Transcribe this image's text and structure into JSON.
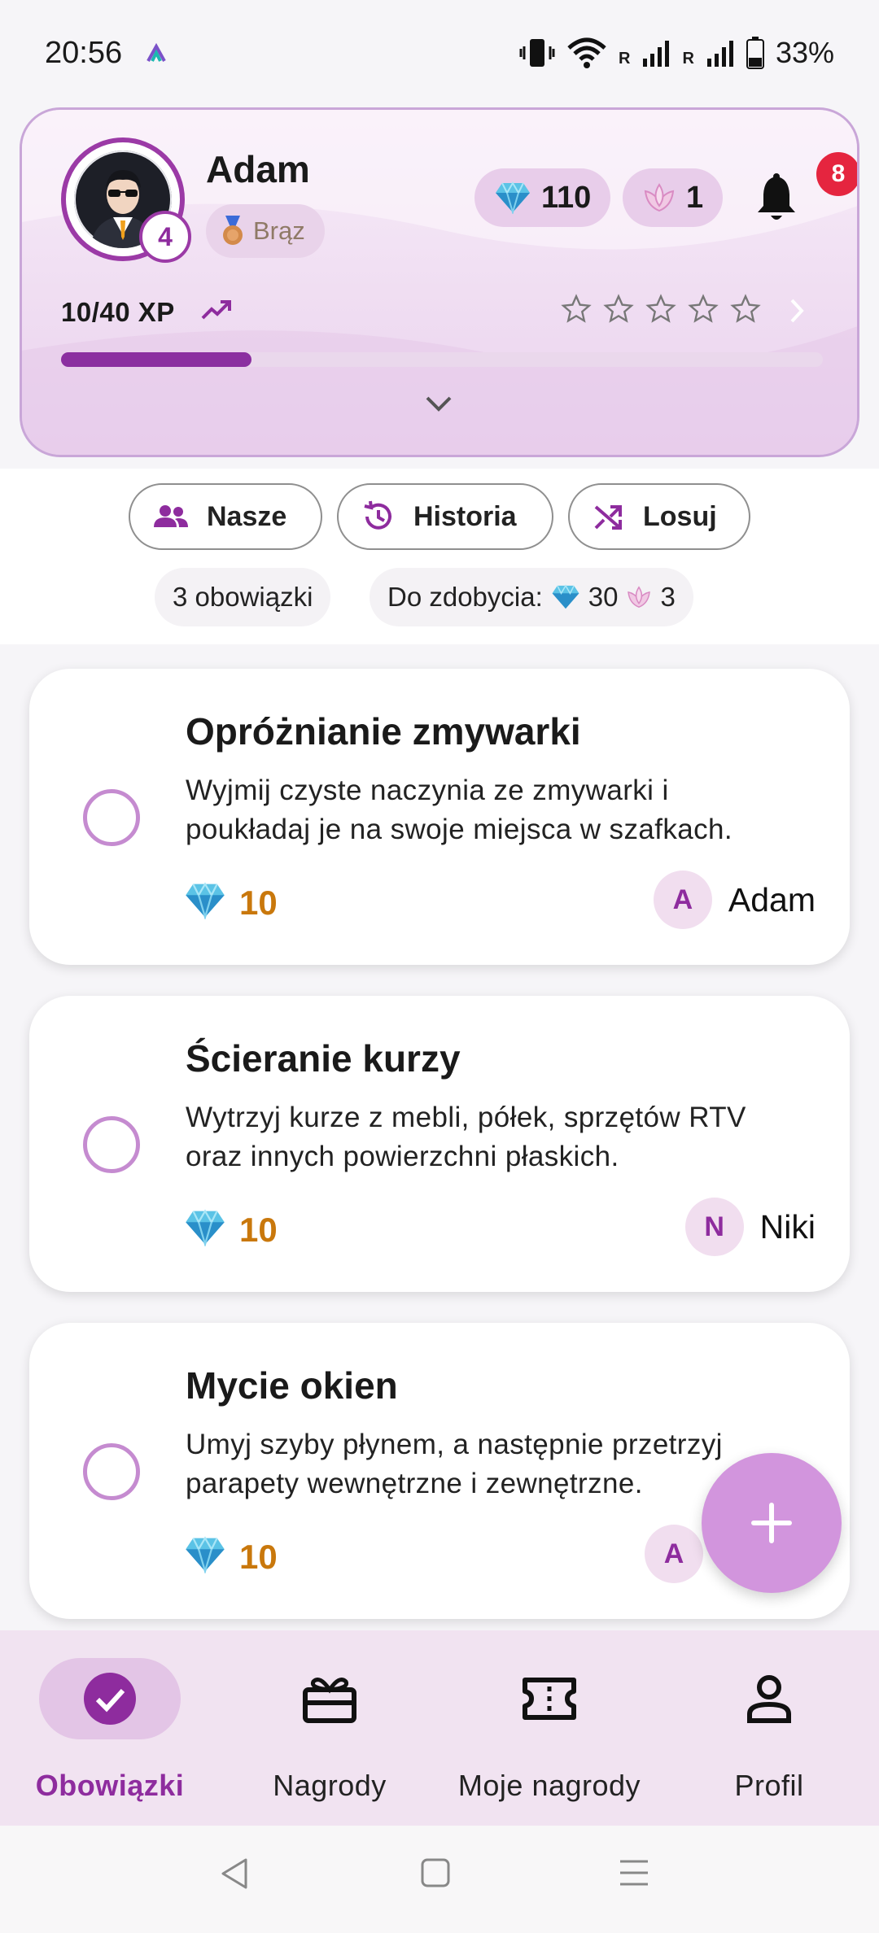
{
  "status_bar": {
    "time": "20:56",
    "roaming1": "R",
    "roaming2": "R",
    "battery": "33%"
  },
  "profile": {
    "name": "Adam",
    "level": "4",
    "rank": "Brąz",
    "gems": "110",
    "flowers": "1",
    "notifications": "8",
    "xp_text": "10/40 XP",
    "xp_progress": 0.25,
    "stars_filled": 0,
    "stars_total": 5
  },
  "filters": {
    "ours": "Nasze",
    "history": "Historia",
    "random": "Losuj"
  },
  "summary": {
    "count": "3 obowiązki",
    "earn_label": "Do zdobycia:",
    "earn_gems": "30",
    "earn_flowers": "3"
  },
  "tasks": [
    {
      "title": "Opróżnianie zmywarki",
      "desc_line1": "Wyjmij czyste naczynia ze zmywarki i",
      "desc_line2": "poukładaj je na swoje miejsca w szafkach.",
      "points": "10",
      "assignee_initial": "A",
      "assignee_name": "Adam"
    },
    {
      "title": "Ścieranie kurzy",
      "desc_line1": "Wytrzyj kurze z mebli, półek, sprzętów RTV",
      "desc_line2": "oraz innych powierzchni płaskich.",
      "points": "10",
      "assignee_initial": "N",
      "assignee_name": "Niki"
    },
    {
      "title": "Mycie okien",
      "desc_line1": "Umyj szyby płynem, a następnie przetrzyj",
      "desc_line2": "parapety wewnętrzne i zewnętrzne.",
      "points": "10",
      "assignee_initial": "A",
      "assignee_name": ""
    }
  ],
  "bottom_nav": {
    "tasks": "Obowiązki",
    "rewards": "Nagrody",
    "my_rewards": "Moje nagrody",
    "profile": "Profil"
  },
  "colors": {
    "accent": "#8e2c9e",
    "fab": "#d295dd",
    "points": "#c9780c",
    "notification": "#e5253f"
  }
}
